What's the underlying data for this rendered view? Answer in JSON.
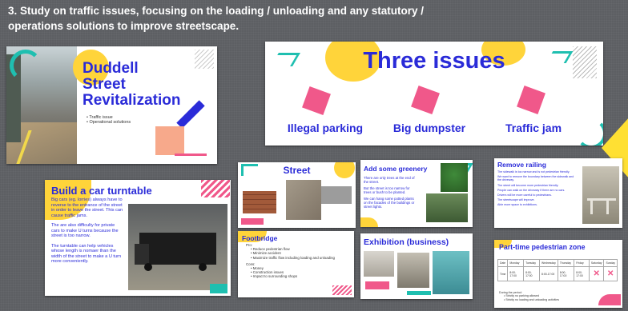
{
  "heading": {
    "line1": "3.   Study on traffic issues, focusing on the loading / unloading and any statutory /",
    "line2": "operations solutions to improve streetscape."
  },
  "slides": {
    "duddell": {
      "title_line1": "Duddell",
      "title_line2": "Street",
      "title_line3": "Revitalization",
      "bullets": [
        "Traffic issue",
        "Operational solutions"
      ]
    },
    "three_issues": {
      "title": "Three issues",
      "issues": [
        "Illegal parking",
        "Big dumpster",
        "Traffic jam"
      ]
    },
    "turntable": {
      "title": "Build a car turntable",
      "paragraphs": [
        "Big cars (eg. lorries) always have to reverse to the entrance of the street in order to leave the street. This can cause traffic jams.",
        "The are also difficulty for private cars to make U turns because the street is too narrow.",
        "The turntable can help vehicles whose length is nomaer than the width of the street to make a U turn more conveniently."
      ]
    },
    "street": {
      "title": "Street"
    },
    "greenery": {
      "title": "Add some greenery",
      "paragraphs": [
        "There are only trees at the end of the street.",
        "But the street is too narrow for trees or bush to be planted.",
        "We can hang some potted plants on the facades of the buildings or street lights."
      ]
    },
    "railing": {
      "title": "Remove railing",
      "paragraphs": [
        "The sidewalk is too narrow and is not pedestrian friendly.",
        "We want to remove the boundary between the sidewalk and the driveway.",
        "The street will become more pedestrian friendly.",
        "People can walk on the driveway if there are no cars.",
        "Drivers will be more careful to pedestrians.",
        "The streetscape will improve.",
        "Able more space to exhibitions."
      ]
    },
    "footbridge": {
      "title": "Footbridge",
      "pro_label": "Pro:",
      "pros": [
        "Reduce pedestrian flow",
        "Minimize accident",
        "Maximize traffic flow including loading and unloading"
      ],
      "cons_label": "Cons:",
      "cons": [
        "Money",
        "Construction issues",
        "Impact to surrounding shops"
      ]
    },
    "exhibition": {
      "title": "Exhibition (business)"
    },
    "parttime": {
      "title": "Part-time pedestrian zone",
      "header": [
        "Date",
        "Monday",
        "Tuesday",
        "Wednesday",
        "Thursday",
        "Friday",
        "Saturday",
        "Sunday"
      ],
      "row_label": "Time",
      "row": [
        "8:00-17:00",
        "8:00-17:00",
        "8:00-17:00",
        "8:00-17:00",
        "8:00-17:00"
      ],
      "notes": [
        "During the period:",
        "Strictly no parking allowed",
        "Strictly no loading and unloading activities"
      ]
    }
  },
  "colors": {
    "blue": "#2a2bd8",
    "pink": "#f0588a",
    "yellow": "#ffd43a",
    "teal": "#1fbfb0"
  }
}
